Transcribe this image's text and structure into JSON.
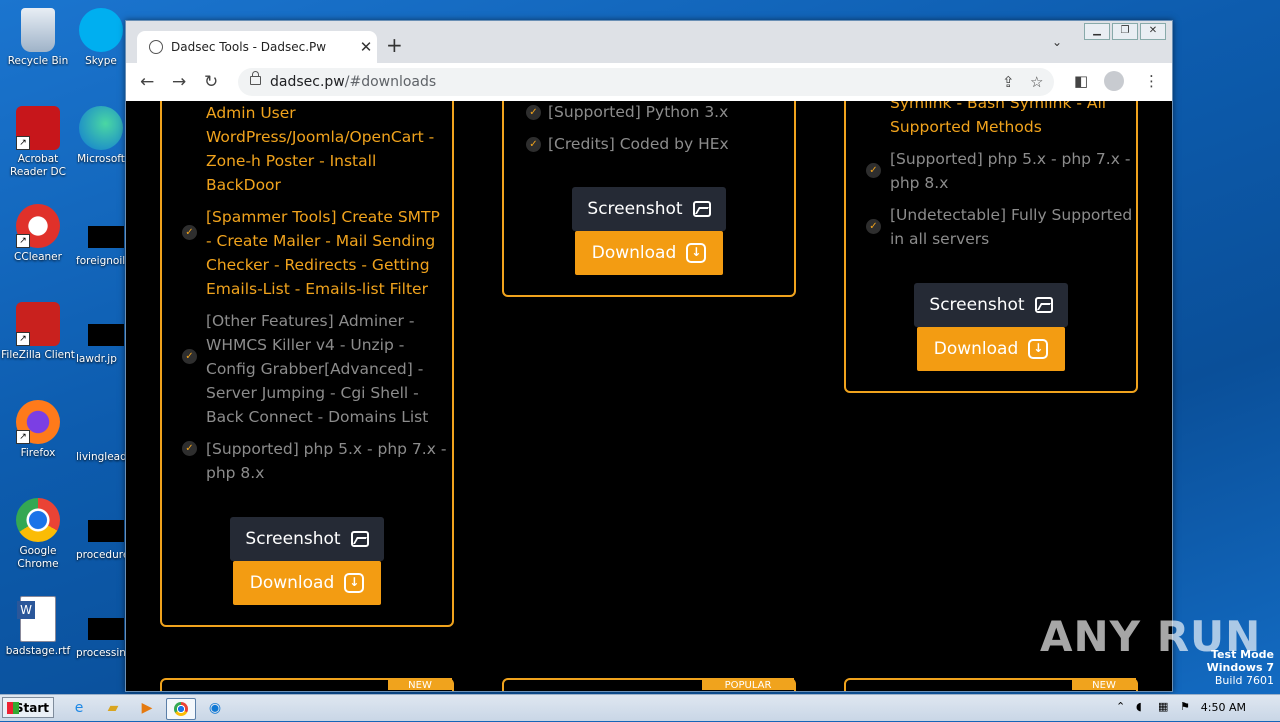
{
  "desktop": {
    "icons": [
      {
        "label": "Recycle Bin",
        "icon": "recycle-bin-icon"
      },
      {
        "label": "Acrobat Reader DC",
        "icon": "acrobat-icon"
      },
      {
        "label": "CCleaner",
        "icon": "ccleaner-icon"
      },
      {
        "label": "FileZilla Client",
        "icon": "filezilla-icon"
      },
      {
        "label": "Firefox",
        "icon": "firefox-icon"
      },
      {
        "label": "Google Chrome",
        "icon": "chrome-icon"
      },
      {
        "label": "badstage.rtf",
        "icon": "word-doc-icon"
      }
    ],
    "icons2": [
      {
        "label": "Skype"
      },
      {
        "label": "Microsoft"
      },
      {
        "label": "foreignoil"
      },
      {
        "label": "lawdr.jp"
      },
      {
        "label": "livinglead"
      },
      {
        "label": "procedure"
      },
      {
        "label": "processin"
      }
    ]
  },
  "browser": {
    "tab_title": "Dadsec Tools - Dadsec.Pw",
    "url_host": "dadsec.pw",
    "url_path": "/#downloads"
  },
  "cards": {
    "left": {
      "features": [
        {
          "text": "Admin User\nWordPress/Joomla/OpenCart -\nZone-h Poster - Install\nBackDoor",
          "style": "orange"
        },
        {
          "text": "[Spammer Tools] Create SMTP\n- Create Mailer - Mail Sending\nChecker - Redirects - Getting\nEmails-List - Emails-list Filter",
          "style": "orange"
        },
        {
          "text": "[Other Features] Adminer -\nWHMCS Killer v4 - Unzip -\nConfig Grabber[Advanced] -\nServer Jumping - Cgi Shell -\nBack Connect - Domains List",
          "style": "gray"
        },
        {
          "text": "[Supported] php 5.x - php 7.x -\nphp 8.x",
          "style": "gray"
        }
      ],
      "screenshot_label": "Screenshot",
      "download_label": "Download",
      "ribbon": "NEW"
    },
    "middle": {
      "features": [
        {
          "text": "[Supported] Python 3.x",
          "style": "gray"
        },
        {
          "text": "[Credits] Coded by HEx",
          "style": "gray"
        }
      ],
      "screenshot_label": "Screenshot",
      "download_label": "Download",
      "ribbon": "POPULAR"
    },
    "right": {
      "features": [
        {
          "text": "Symlink - Bash Symlink - All\nSupported Methods",
          "style": "orange"
        },
        {
          "text": "[Supported] php 5.x - php 7.x -\nphp 8.x",
          "style": "gray"
        },
        {
          "text": "[Undetectable] Fully Supported\nin all servers",
          "style": "gray"
        }
      ],
      "screenshot_label": "Screenshot",
      "download_label": "Download",
      "ribbon": "NEW"
    }
  },
  "watermark": "ANY RUN",
  "os_overlay": {
    "line1": "Test Mode",
    "line2": "Windows 7",
    "line3": "Build 7601"
  },
  "taskbar": {
    "start_label": "Start",
    "clock": "4:50 AM"
  },
  "colors": {
    "accent": "#f0a31d",
    "download_button": "#f39c12",
    "screenshot_button": "#252a35"
  }
}
